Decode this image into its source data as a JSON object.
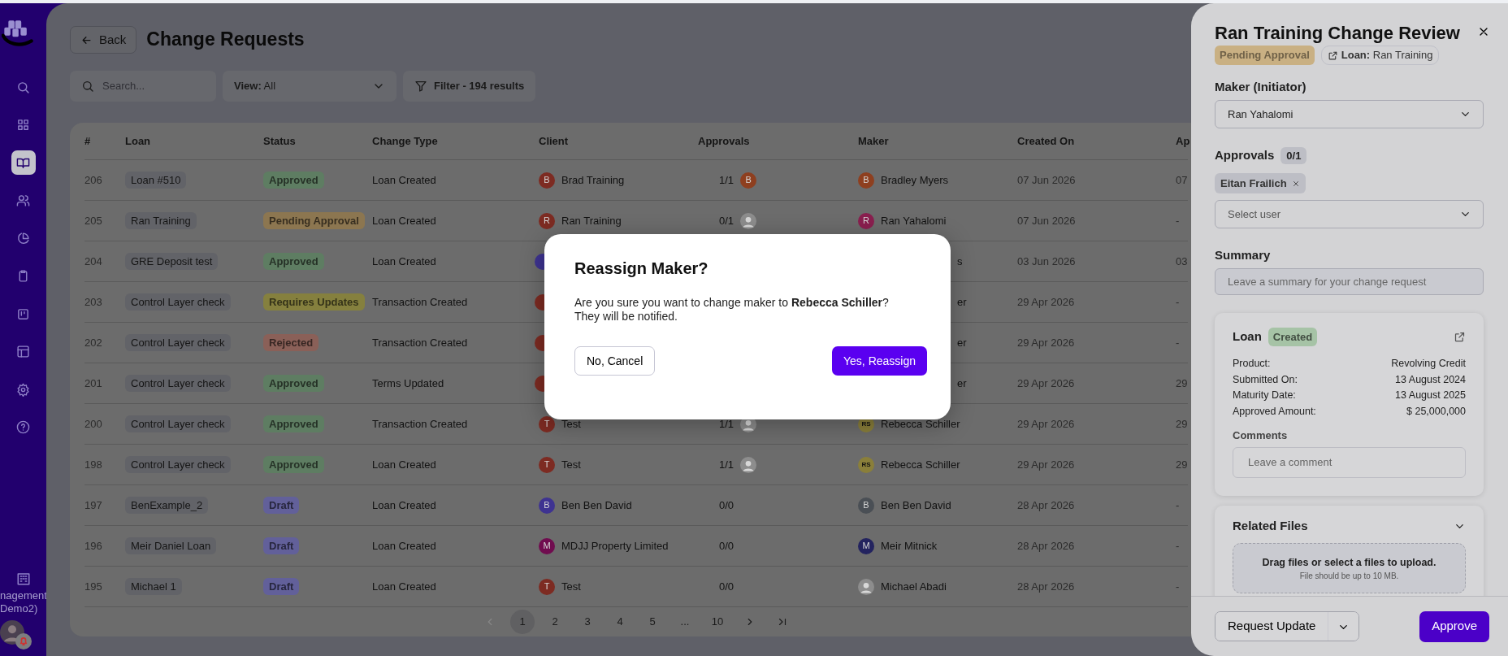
{
  "sidebar": {
    "items": [
      {
        "selected": false
      },
      {
        "selected": false
      },
      {
        "selected": true
      },
      {
        "selected": false
      },
      {
        "selected": false
      },
      {
        "selected": false
      },
      {
        "selected": false
      },
      {
        "selected": false
      },
      {
        "selected": false
      },
      {
        "selected": false
      }
    ],
    "org_lines": [
      "nagement",
      "Demo2)"
    ]
  },
  "header": {
    "back": "Back",
    "title": "Change Requests"
  },
  "toolbar": {
    "search_placeholder": "Search...",
    "view_label": "View:",
    "view_value": "All",
    "filter": "Filter - 194 results"
  },
  "table": {
    "columns": [
      "#",
      "Loan",
      "Status",
      "Change Type",
      "Client",
      "Approvals",
      "Maker",
      "Created On",
      "Ap"
    ],
    "rows": [
      {
        "num": "206",
        "loan": "Loan #510",
        "status": {
          "text": "Approved",
          "color": "#5e7d62"
        },
        "change_type": "Loan Created",
        "covered": false,
        "client": {
          "initial": "B",
          "color": "#7d2b22",
          "name": "Brad Training"
        },
        "approvals": {
          "count": "1/1",
          "avatar": {
            "kind": "letter",
            "initial": "B",
            "color": "#8e3f1f"
          }
        },
        "maker": {
          "kind": "letter",
          "initial": "B",
          "color": "#8e3f1f",
          "name": "Bradley Myers"
        },
        "created_on": "07 Jun 2026",
        "column_9": "07"
      },
      {
        "num": "205",
        "loan": "Ran Training",
        "status": {
          "text": "Pending Approval",
          "color": "#8c7650"
        },
        "change_type": "Loan Created",
        "covered": false,
        "client": {
          "initial": "R",
          "color": "#7d2b22",
          "name": "Ran Training"
        },
        "approvals": {
          "count": "0/1",
          "avatar": {
            "kind": "photo"
          }
        },
        "maker": {
          "kind": "letter",
          "initial": "R",
          "color": "#8a1f4f",
          "name": "Ran Yahalomi"
        },
        "created_on": "07 Jun 2026",
        "column_9": "-"
      },
      {
        "num": "204",
        "loan": "GRE Deposit test",
        "status": {
          "text": "Approved",
          "color": "#5e7d62"
        },
        "change_type": "Loan Created",
        "covered": true,
        "client": {
          "color": "#3e3391"
        },
        "maker": {
          "name": "s"
        },
        "created_on": "03 Jun 2026",
        "column_9": "03"
      },
      {
        "num": "203",
        "loan": "Control Layer check",
        "status": {
          "text": "Requires Updates",
          "color": "#85803e"
        },
        "change_type": "Transaction Created",
        "covered": true,
        "client": {
          "color": "#7d2b22"
        },
        "maker": {
          "name": "er"
        },
        "created_on": "29 Apr 2026",
        "column_9": "-"
      },
      {
        "num": "202",
        "loan": "Control Layer check",
        "status": {
          "text": "Rejected",
          "color": "#8a6058"
        },
        "change_type": "Transaction Created",
        "covered": true,
        "client": {
          "color": "#7d2b22"
        },
        "maker": {
          "name": "er"
        },
        "created_on": "29 Apr 2026",
        "column_9": "-"
      },
      {
        "num": "201",
        "loan": "Control Layer check",
        "status": {
          "text": "Approved",
          "color": "#5e7d62"
        },
        "change_type": "Terms Updated",
        "covered": true,
        "client": {
          "color": "#7d2b22"
        },
        "maker": {
          "name": "er"
        },
        "created_on": "29 Apr 2026",
        "column_9": "29"
      },
      {
        "num": "200",
        "loan": "Control Layer check",
        "status": {
          "text": "Approved",
          "color": "#5e7d62"
        },
        "change_type": "Transaction Created",
        "covered": false,
        "client": {
          "initial": "T",
          "color": "#7d2b22",
          "name": "Test"
        },
        "approvals": {
          "count": "1/1",
          "avatar": {
            "kind": "photo"
          }
        },
        "maker": {
          "kind": "letter",
          "initial": "RS",
          "color": "#8a7f3a",
          "name": "Rebecca Schiller"
        },
        "created_on": "29 Apr 2026",
        "column_9": "29"
      },
      {
        "num": "198",
        "loan": "Control Layer check",
        "status": {
          "text": "Approved",
          "color": "#5e7d62"
        },
        "change_type": "Loan Created",
        "covered": false,
        "client": {
          "initial": "T",
          "color": "#7d2b22",
          "name": "Test"
        },
        "approvals": {
          "count": "1/1",
          "avatar": {
            "kind": "photo"
          }
        },
        "maker": {
          "kind": "letter",
          "initial": "RS",
          "color": "#8a7f3a",
          "name": "Rebecca Schiller"
        },
        "created_on": "29 Apr 2026",
        "column_9": "29"
      },
      {
        "num": "197",
        "loan": "BenExample_2",
        "status": {
          "text": "Draft",
          "color": "#62609a"
        },
        "change_type": "Loan Created",
        "covered": false,
        "client": {
          "initial": "B",
          "color": "#3e3391",
          "name": "Ben Ben David"
        },
        "approvals": {
          "count": "0/0"
        },
        "maker": {
          "kind": "letter",
          "initial": "B",
          "color": "#4a4f55",
          "name": "Ben Ben David"
        },
        "created_on": "28 Apr 2026",
        "column_9": "-"
      },
      {
        "num": "196",
        "loan": "Meir Daniel Loan",
        "status": {
          "text": "Draft",
          "color": "#62609a"
        },
        "change_type": "Loan Created",
        "covered": false,
        "client": {
          "initial": "M",
          "color": "#700c4f",
          "name": "MDJJ Property Limited"
        },
        "approvals": {
          "count": "0/0"
        },
        "maker": {
          "kind": "letter",
          "initial": "M",
          "color": "#23235f",
          "name": "Meir Mitnick"
        },
        "created_on": "28 Apr 2026",
        "column_9": "-"
      },
      {
        "num": "195",
        "loan": "Michael 1",
        "status": {
          "text": "Draft",
          "color": "#62609a"
        },
        "change_type": "Loan Created",
        "covered": false,
        "client": {
          "initial": "T",
          "color": "#7d2b22",
          "name": "Test"
        },
        "approvals": {
          "count": "0/0"
        },
        "maker": {
          "kind": "photo",
          "name": "Michael Abadi"
        },
        "created_on": "28 Apr 2026",
        "column_9": "-"
      }
    ]
  },
  "pagination": {
    "pages": [
      {
        "label": "1",
        "selected": true
      },
      {
        "label": "2",
        "selected": false
      },
      {
        "label": "3",
        "selected": false
      },
      {
        "label": "4",
        "selected": false
      },
      {
        "label": "5",
        "selected": false
      },
      {
        "label": "...",
        "selected": false
      },
      {
        "label": "10",
        "selected": false
      }
    ]
  },
  "drawer": {
    "title": "Ran Training Change Review",
    "status": {
      "text": "Pending Approval",
      "color": "#c9b083"
    },
    "loan_link": "**Loan:** Ran Training",
    "maker_label": "Maker (Initiator)",
    "maker_value": "Ran Yahalomi",
    "approvals_label": "Approvals",
    "approvals_count": "0/1",
    "approvers": [
      "Eitan Frailich"
    ],
    "select_placeholder": "Select user",
    "summary_label": "Summary",
    "summary_placeholder": "Leave a summary for your change request",
    "loan_card": {
      "title": "Loan",
      "badge": {
        "text": "Created",
        "color": "#a6c3a6"
      },
      "details": [
        {
          "label": "Product:",
          "value": "Revolving Credit"
        },
        {
          "label": "Submitted On:",
          "value": "13 August 2024"
        },
        {
          "label": "Maturity Date:",
          "value": "13 August 2025"
        },
        {
          "label": "Approved Amount:",
          "value": "$ 25,000,000"
        }
      ],
      "comments_label": "Comments",
      "comments_placeholder": "Leave a comment"
    },
    "files_card": {
      "title": "Related Files",
      "drop_text": "Drag files or select a files to upload.",
      "drop_hint": "File should be up to 10 MB."
    },
    "footer": {
      "request_update": "Request Update",
      "approve": "Approve"
    }
  },
  "modal": {
    "title": "Reassign Maker?",
    "body": "Are you sure you want to change maker to **Rebecca Schiller**?\nThey will be notified.",
    "cancel": "No, Cancel",
    "confirm": "Yes, Reassign"
  }
}
